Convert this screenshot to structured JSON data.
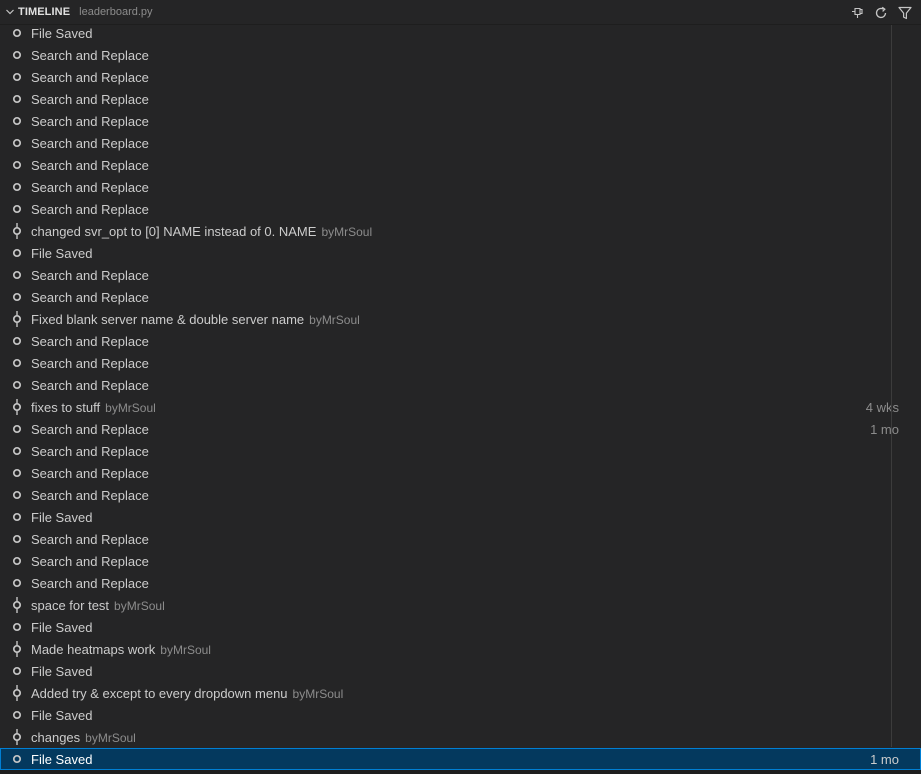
{
  "header": {
    "title": "TIMELINE",
    "file": "leaderboard.py",
    "actions": [
      {
        "icon": "pin-icon"
      },
      {
        "icon": "refresh-icon"
      },
      {
        "icon": "filter-icon"
      }
    ]
  },
  "timeline": [
    {
      "kind": "local",
      "label": "File Saved",
      "author": "",
      "time": ""
    },
    {
      "kind": "local",
      "label": "Search and Replace",
      "author": "",
      "time": ""
    },
    {
      "kind": "local",
      "label": "Search and Replace",
      "author": "",
      "time": ""
    },
    {
      "kind": "local",
      "label": "Search and Replace",
      "author": "",
      "time": ""
    },
    {
      "kind": "local",
      "label": "Search and Replace",
      "author": "",
      "time": ""
    },
    {
      "kind": "local",
      "label": "Search and Replace",
      "author": "",
      "time": ""
    },
    {
      "kind": "local",
      "label": "Search and Replace",
      "author": "",
      "time": ""
    },
    {
      "kind": "local",
      "label": "Search and Replace",
      "author": "",
      "time": ""
    },
    {
      "kind": "local",
      "label": "Search and Replace",
      "author": "",
      "time": ""
    },
    {
      "kind": "commit",
      "label": "changed svr_opt to [0] NAME instead of 0. NAME",
      "author": "byMrSoul",
      "time": ""
    },
    {
      "kind": "local",
      "label": "File Saved",
      "author": "",
      "time": ""
    },
    {
      "kind": "local",
      "label": "Search and Replace",
      "author": "",
      "time": ""
    },
    {
      "kind": "local",
      "label": "Search and Replace",
      "author": "",
      "time": ""
    },
    {
      "kind": "commit",
      "label": "Fixed blank server name & double server name",
      "author": "byMrSoul",
      "time": ""
    },
    {
      "kind": "local",
      "label": "Search and Replace",
      "author": "",
      "time": ""
    },
    {
      "kind": "local",
      "label": "Search and Replace",
      "author": "",
      "time": ""
    },
    {
      "kind": "local",
      "label": "Search and Replace",
      "author": "",
      "time": ""
    },
    {
      "kind": "commit",
      "label": "fixes to stuff",
      "author": "byMrSoul",
      "time": "4 wks"
    },
    {
      "kind": "local",
      "label": "Search and Replace",
      "author": "",
      "time": "1 mo"
    },
    {
      "kind": "local",
      "label": "Search and Replace",
      "author": "",
      "time": ""
    },
    {
      "kind": "local",
      "label": "Search and Replace",
      "author": "",
      "time": ""
    },
    {
      "kind": "local",
      "label": "Search and Replace",
      "author": "",
      "time": ""
    },
    {
      "kind": "local",
      "label": "File Saved",
      "author": "",
      "time": ""
    },
    {
      "kind": "local",
      "label": "Search and Replace",
      "author": "",
      "time": ""
    },
    {
      "kind": "local",
      "label": "Search and Replace",
      "author": "",
      "time": ""
    },
    {
      "kind": "local",
      "label": "Search and Replace",
      "author": "",
      "time": ""
    },
    {
      "kind": "commit",
      "label": "space for test",
      "author": "byMrSoul",
      "time": ""
    },
    {
      "kind": "local",
      "label": "File Saved",
      "author": "",
      "time": ""
    },
    {
      "kind": "commit",
      "label": "Made heatmaps work",
      "author": "byMrSoul",
      "time": ""
    },
    {
      "kind": "local",
      "label": "File Saved",
      "author": "",
      "time": ""
    },
    {
      "kind": "commit",
      "label": "Added try & except to every dropdown menu",
      "author": "byMrSoul",
      "time": ""
    },
    {
      "kind": "local",
      "label": "File Saved",
      "author": "",
      "time": ""
    },
    {
      "kind": "commit",
      "label": "changes",
      "author": "byMrSoul",
      "time": ""
    },
    {
      "kind": "local",
      "label": "File Saved",
      "author": "",
      "time": "1 mo",
      "selected": true
    }
  ],
  "colors": {
    "background": "#252526",
    "selection": "#04395e",
    "selection_border": "#007fd4",
    "text": "#cccccc",
    "muted": "#8c8c8c"
  }
}
